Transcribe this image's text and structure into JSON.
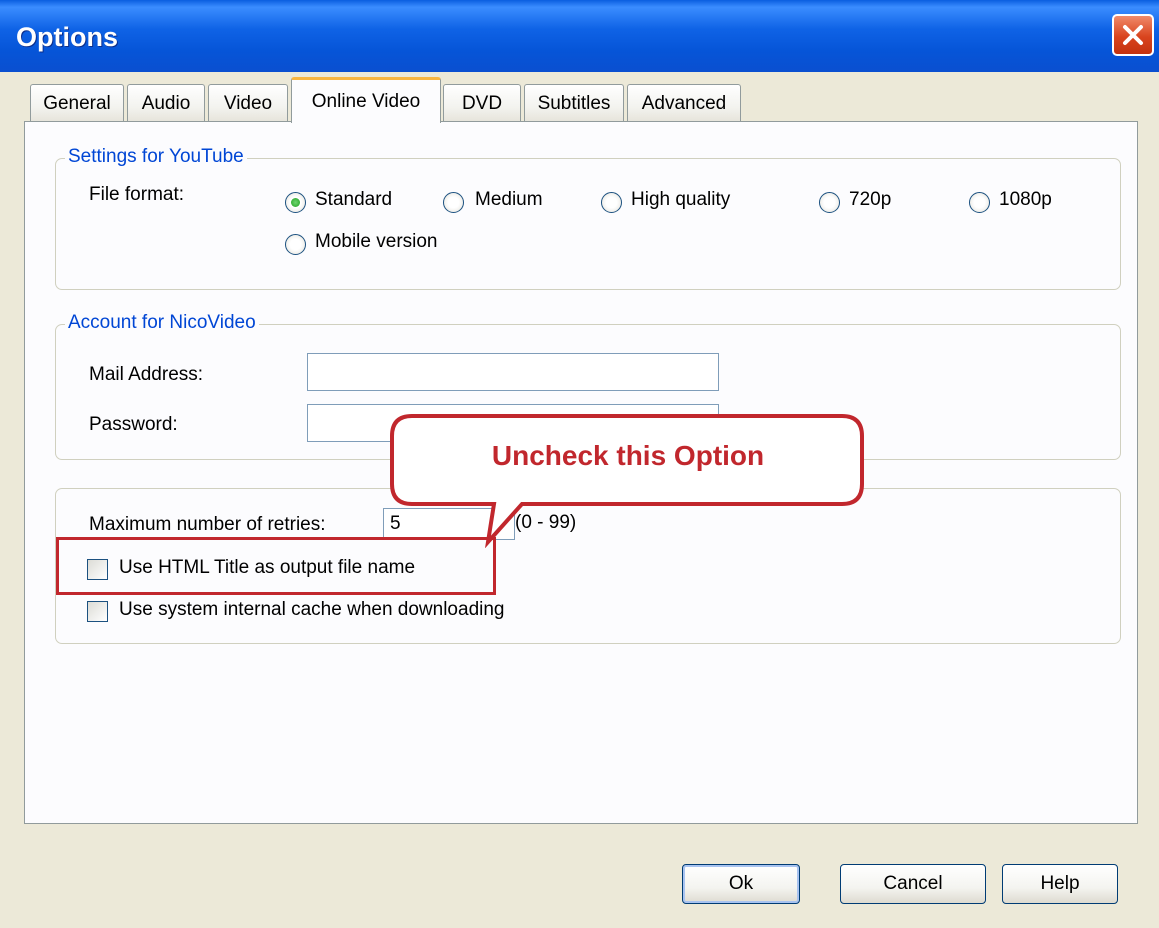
{
  "window": {
    "title": "Options"
  },
  "tabs": [
    {
      "label": "General"
    },
    {
      "label": "Audio"
    },
    {
      "label": "Video"
    },
    {
      "label": "Online Video",
      "active": true
    },
    {
      "label": "DVD"
    },
    {
      "label": "Subtitles"
    },
    {
      "label": "Advanced"
    }
  ],
  "youtube": {
    "legend": "Settings for YouTube",
    "file_format_label": "File format:",
    "options": [
      {
        "label": "Standard",
        "checked": true
      },
      {
        "label": "Medium"
      },
      {
        "label": "High quality"
      },
      {
        "label": "720p"
      },
      {
        "label": "1080p"
      },
      {
        "label": "Mobile version"
      }
    ]
  },
  "nicovideo": {
    "legend": "Account for NicoVideo",
    "mail_label": "Mail Address:",
    "mail_value": "",
    "password_label": "Password:",
    "password_value": ""
  },
  "misc": {
    "retries_label": "Maximum number of retries:",
    "retries_value": "5",
    "retries_range": "(0 - 99)",
    "html_title_label": "Use HTML Title as output file name",
    "html_title_checked": false,
    "cache_label": "Use system internal cache when downloading",
    "cache_checked": false
  },
  "annotation": {
    "text": "Uncheck this Option",
    "color": "#c1272d"
  },
  "buttons": {
    "ok": "Ok",
    "cancel": "Cancel",
    "help": "Help"
  },
  "colors": {
    "titlebar": "#0a5ee0",
    "legend": "#0046d5",
    "tab_active_accent": "#f9b640"
  }
}
